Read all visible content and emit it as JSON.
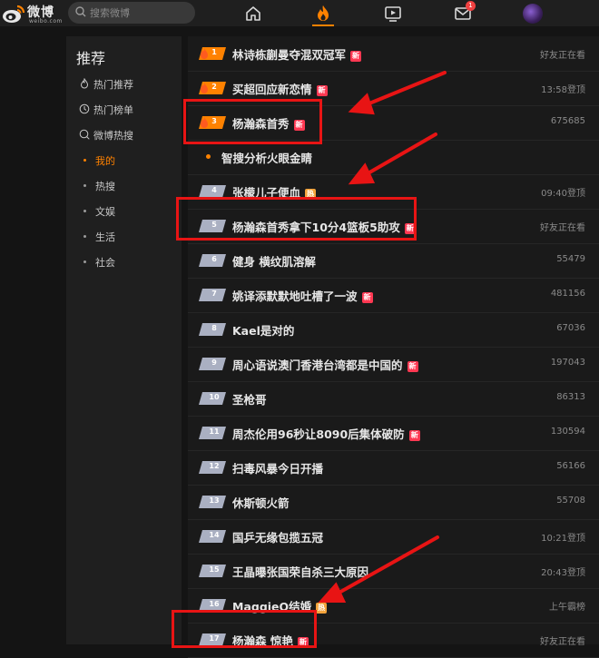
{
  "topbar": {
    "logo_text": "微博",
    "logo_sub": "weibo.com",
    "search_placeholder": "搜索微博",
    "nav_icons": [
      "home-icon",
      "fire-icon",
      "video-icon",
      "mail-icon"
    ],
    "mail_badge": "1",
    "active_tab": "fire-icon",
    "accent": "#ff8200"
  },
  "sidenav": {
    "title": "推荐",
    "items": [
      {
        "label": "热门推荐",
        "icon": "fire-outline-icon"
      },
      {
        "label": "热门榜单",
        "icon": "clock-icon"
      },
      {
        "label": "微博热搜",
        "icon": "search-outline-icon"
      }
    ],
    "subitems": [
      {
        "label": "我的",
        "active": true
      },
      {
        "label": "热搜",
        "active": false
      },
      {
        "label": "文娱",
        "active": false
      },
      {
        "label": "生活",
        "active": false
      },
      {
        "label": "社会",
        "active": false
      }
    ]
  },
  "list": [
    {
      "rank": "1",
      "title": "林诗栋蒯曼夺混双冠军",
      "tag": "新",
      "meta": "好友正在看"
    },
    {
      "rank": "2",
      "title": "买超回应新恋情",
      "tag": "新",
      "meta": "13:58登顶"
    },
    {
      "rank": "3",
      "title": "杨瀚森首秀",
      "tag": "新",
      "meta": "675685"
    },
    {
      "rank": "",
      "title": "智搜分析火眼金睛",
      "tag": "",
      "meta": "",
      "smart": true
    },
    {
      "rank": "4",
      "title": "张檬儿子便血",
      "tag": "热",
      "meta": "09:40登顶"
    },
    {
      "rank": "5",
      "title": "杨瀚森首秀拿下10分4篮板5助攻",
      "tag": "新",
      "meta": "好友正在看"
    },
    {
      "rank": "6",
      "title": "健身 横纹肌溶解",
      "tag": "",
      "meta": "55479"
    },
    {
      "rank": "7",
      "title": "姚译添默默地吐槽了一波",
      "tag": "新",
      "meta": "481156"
    },
    {
      "rank": "8",
      "title": "Kael是对的",
      "tag": "",
      "meta": "67036"
    },
    {
      "rank": "9",
      "title": "周心语说澳门香港台湾都是中国的",
      "tag": "新",
      "meta": "197043"
    },
    {
      "rank": "10",
      "title": "圣枪哥",
      "tag": "",
      "meta": "86313"
    },
    {
      "rank": "11",
      "title": "周杰伦用96秒让8090后集体破防",
      "tag": "新",
      "meta": "130594"
    },
    {
      "rank": "12",
      "title": "扫毒风暴今日开播",
      "tag": "",
      "meta": "56166"
    },
    {
      "rank": "13",
      "title": "休斯顿火箭",
      "tag": "",
      "meta": "55708"
    },
    {
      "rank": "14",
      "title": "国乒无缘包揽五冠",
      "tag": "",
      "meta": "10:21登顶"
    },
    {
      "rank": "15",
      "title": "王晶曝张国荣自杀三大原因",
      "tag": "",
      "meta": "20:43登顶"
    },
    {
      "rank": "16",
      "title": "MaggieQ结婚",
      "tag": "热",
      "meta": "上午霸榜"
    },
    {
      "rank": "17",
      "title": "杨瀚森 惊艳",
      "tag": "新",
      "meta": "好友正在看"
    }
  ],
  "colors": {
    "rank_top": "#ff8200",
    "rank_normal": "#aab0c2",
    "tag_new": "#ff3852",
    "tag_hot": "#f3a33b",
    "annotation": "#e81414"
  }
}
